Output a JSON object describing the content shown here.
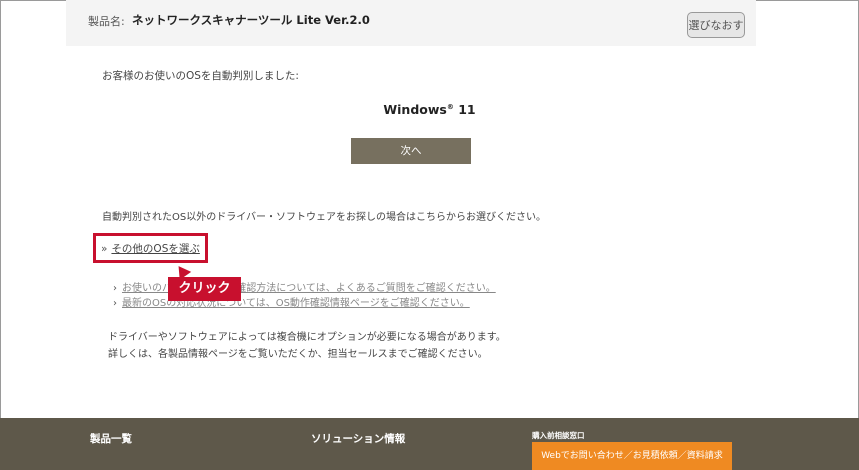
{
  "product_bar": {
    "label": "製品名:",
    "name": "ネットワークスキャナーツール Lite Ver.2.0",
    "reselect": "選びなおす"
  },
  "detection": {
    "message": "お客様のお使いのOSを自動判別しました:",
    "os_name": "Windows",
    "os_mark": "®",
    "os_version": "11",
    "next": "次へ"
  },
  "other": {
    "message": "自動判別されたOS以外のドライバー・ソフトウェアをお探しの場合はこちらからお選びください。",
    "link": "その他のOSを選ぶ",
    "chevron": "»"
  },
  "sub_links": [
    {
      "chevron": "›",
      "text": "お使いのパソコンのOSの確認方法については、よくあるご質問をご確認ください。"
    },
    {
      "chevron": "›",
      "text": "最新のOSの対応状況については、OS動作確認情報ページをご確認ください。"
    }
  ],
  "callout": "クリック",
  "notes": [
    "ドライバーやソフトウェアによっては複合機にオプションが必要になる場合があります。",
    "詳しくは、各製品情報ページをご覧いただくか、担当セールスまでご確認ください。"
  ],
  "footer": {
    "products": "製品一覧",
    "solutions": "ソリューション情報",
    "purchase_heading": "購入前相談窓口",
    "contact_button": "Webでお問い合わせ／お見積依頼／資料請求"
  },
  "colors": {
    "accent_red": "#c8102e",
    "next_button": "#77705f",
    "footer": "#5e584a",
    "contact_orange": "#ef8a22"
  }
}
